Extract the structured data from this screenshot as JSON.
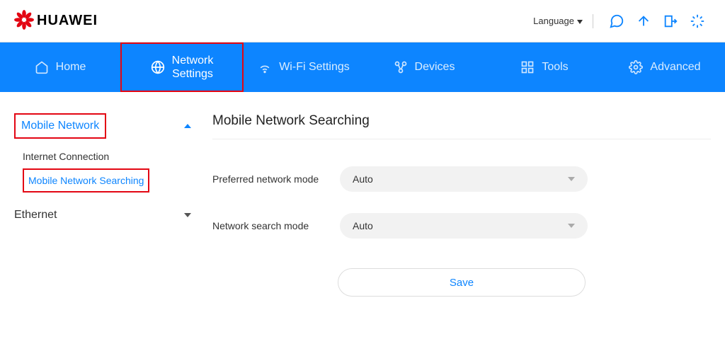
{
  "header": {
    "brand": "HUAWEI",
    "language_label": "Language"
  },
  "nav": {
    "items": [
      {
        "label": "Home"
      },
      {
        "label": "Network Settings"
      },
      {
        "label": "Wi-Fi Settings"
      },
      {
        "label": "Devices"
      },
      {
        "label": "Tools"
      },
      {
        "label": "Advanced"
      }
    ]
  },
  "sidebar": {
    "groups": [
      {
        "label": "Mobile Network",
        "expanded": true,
        "items": [
          {
            "label": "Internet Connection"
          },
          {
            "label": "Mobile Network Searching"
          }
        ]
      },
      {
        "label": "Ethernet",
        "expanded": false
      }
    ]
  },
  "main": {
    "title": "Mobile Network Searching",
    "fields": {
      "preferred_mode": {
        "label": "Preferred network mode",
        "value": "Auto"
      },
      "search_mode": {
        "label": "Network search mode",
        "value": "Auto"
      }
    },
    "save_label": "Save"
  },
  "colors": {
    "brand_blue": "#0d85ff",
    "accent_red": "#e30613"
  }
}
